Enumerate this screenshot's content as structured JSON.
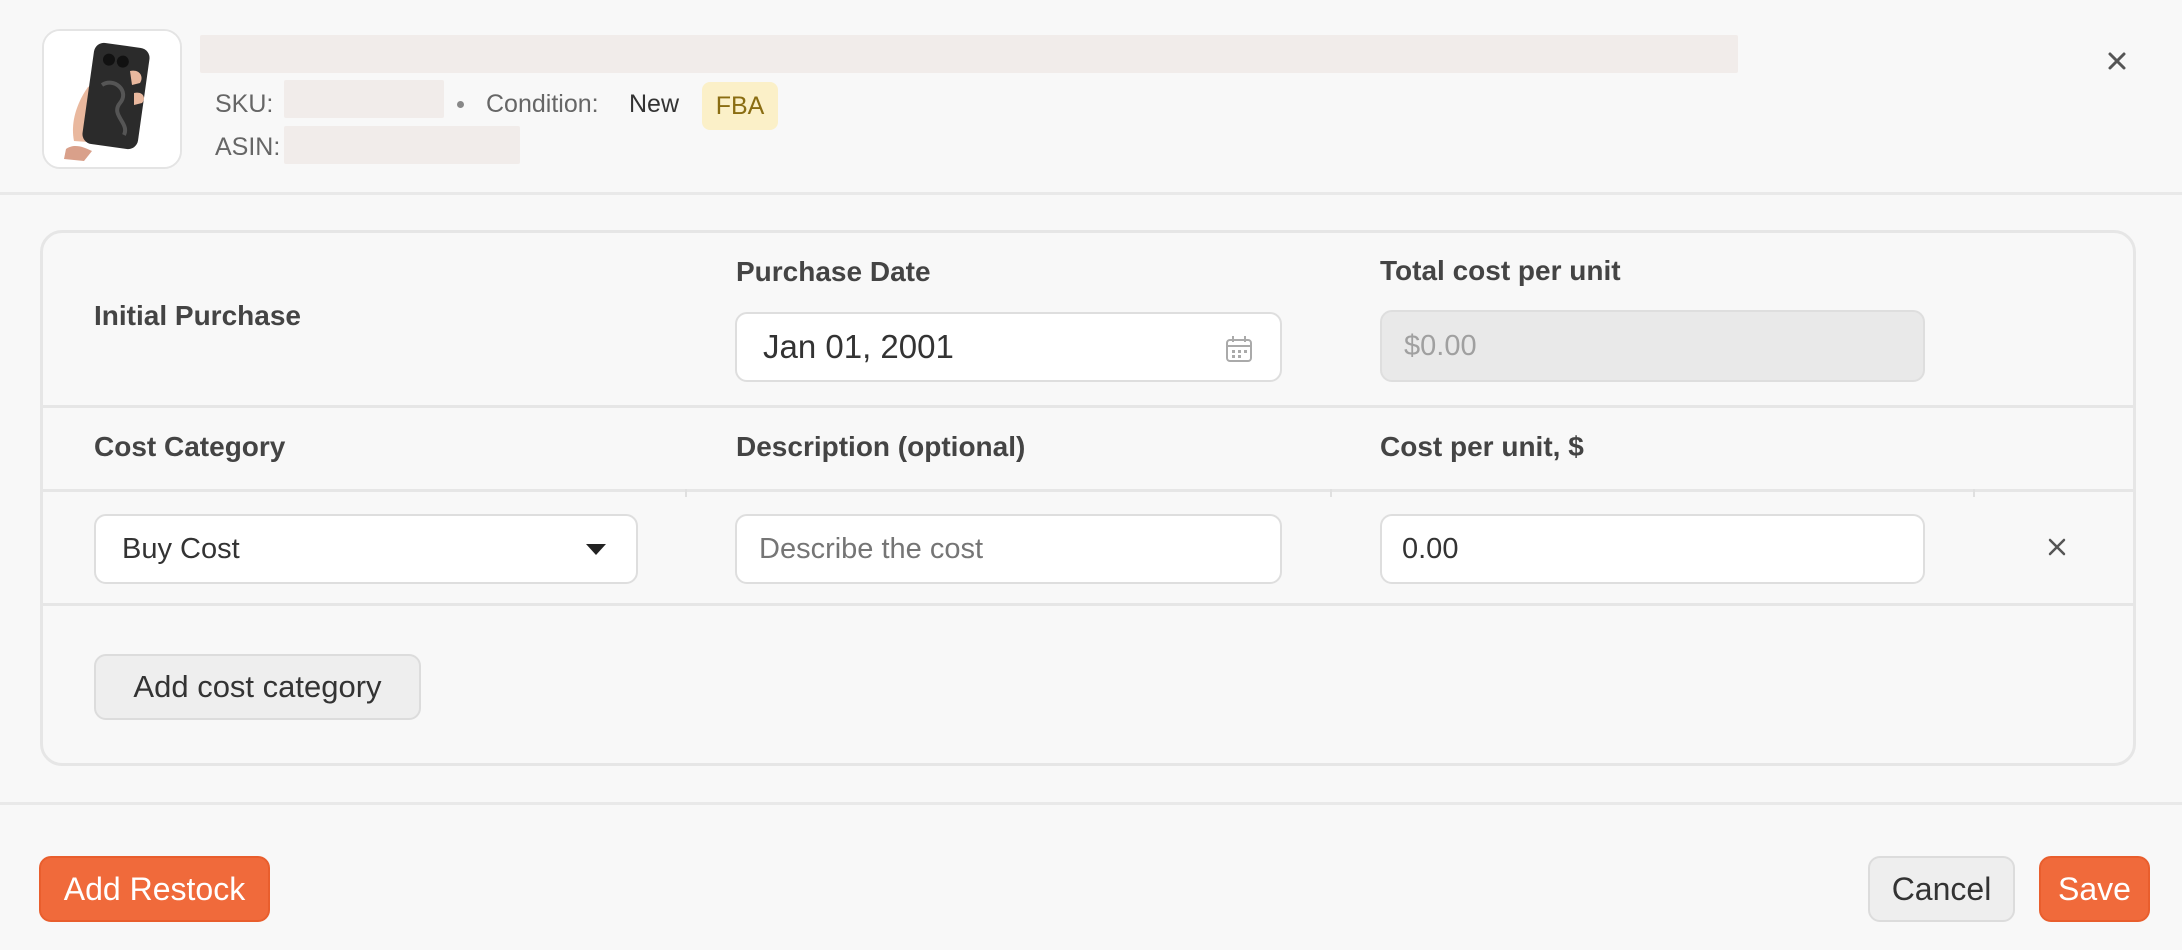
{
  "header": {
    "sku_label": "SKU:",
    "asin_label": "ASIN:",
    "condition_label": "Condition:",
    "condition_value": "New",
    "badge": "FBA",
    "close_icon": "close-icon"
  },
  "card": {
    "initial_purchase_label": "Initial Purchase",
    "purchase_date_label": "Purchase Date",
    "purchase_date_value": "Jan 01, 2001",
    "total_cost_label": "Total cost per unit",
    "total_cost_value": "$0.00",
    "columns": {
      "category": "Cost Category",
      "description": "Description (optional)",
      "cost": "Cost per unit, $"
    },
    "rows": [
      {
        "category": "Buy Cost",
        "description_placeholder": "Describe the cost",
        "cost": "0.00"
      }
    ],
    "add_category_label": "Add cost category"
  },
  "footer": {
    "add_restock_label": "Add Restock",
    "cancel_label": "Cancel",
    "save_label": "Save"
  },
  "colors": {
    "accent": "#f06a3b",
    "badge_bg": "#fbf0c8",
    "badge_text": "#8a6d12"
  }
}
